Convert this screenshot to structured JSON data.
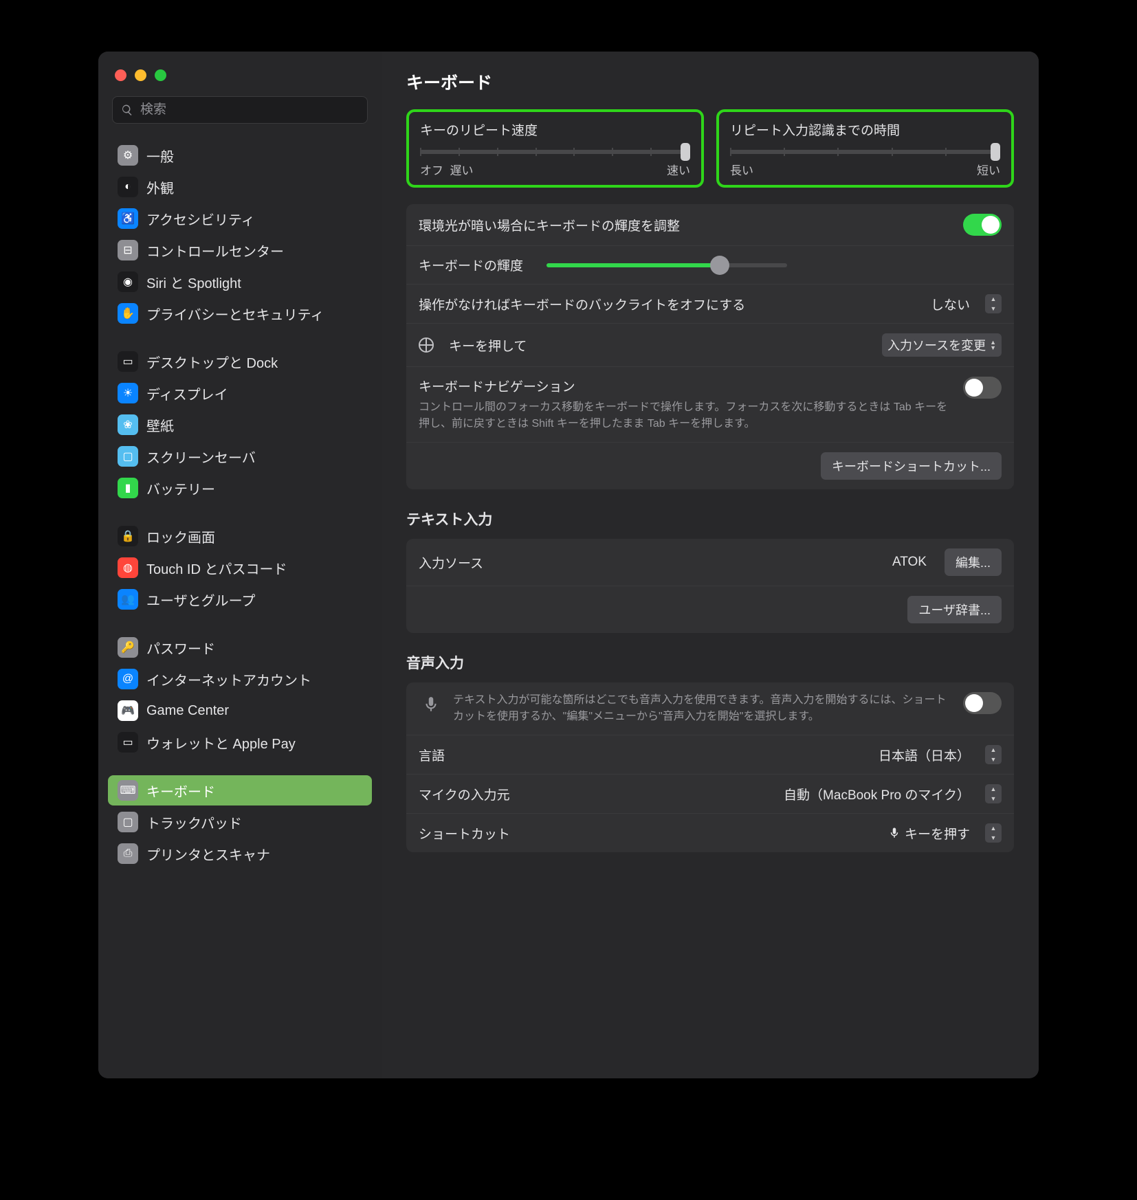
{
  "search_placeholder": "検索",
  "page_title": "キーボード",
  "sidebar": [
    {
      "label": "一般",
      "color": "#8e8e93",
      "glyph": "⚙"
    },
    {
      "label": "外観",
      "color": "#1c1c1e",
      "glyph": "◐"
    },
    {
      "label": "アクセシビリティ",
      "color": "#0a84ff",
      "glyph": "♿"
    },
    {
      "label": "コントロールセンター",
      "color": "#8e8e93",
      "glyph": "⊟"
    },
    {
      "label": "Siri と Spotlight",
      "color": "#1c1c1e",
      "glyph": "◉"
    },
    {
      "label": "プライバシーとセキュリティ",
      "color": "#0a84ff",
      "glyph": "✋"
    },
    {
      "sep": true
    },
    {
      "label": "デスクトップと Dock",
      "color": "#1c1c1e",
      "glyph": "▭"
    },
    {
      "label": "ディスプレイ",
      "color": "#0a84ff",
      "glyph": "☀"
    },
    {
      "label": "壁紙",
      "color": "#55bef0",
      "glyph": "❀"
    },
    {
      "label": "スクリーンセーバ",
      "color": "#55bef0",
      "glyph": "▢"
    },
    {
      "label": "バッテリー",
      "color": "#32d74b",
      "glyph": "▮"
    },
    {
      "sep": true
    },
    {
      "label": "ロック画面",
      "color": "#1c1c1e",
      "glyph": "🔒"
    },
    {
      "label": "Touch ID とパスコード",
      "color": "#ff453a",
      "glyph": "◍"
    },
    {
      "label": "ユーザとグループ",
      "color": "#0a84ff",
      "glyph": "👥"
    },
    {
      "sep": true
    },
    {
      "label": "パスワード",
      "color": "#8e8e93",
      "glyph": "🔑"
    },
    {
      "label": "インターネットアカウント",
      "color": "#0a84ff",
      "glyph": "@"
    },
    {
      "label": "Game Center",
      "color": "#fff",
      "glyph": "🎮"
    },
    {
      "label": "ウォレットと Apple Pay",
      "color": "#1c1c1e",
      "glyph": "▭"
    },
    {
      "sep": true
    },
    {
      "label": "キーボード",
      "color": "#8e8e93",
      "glyph": "⌨",
      "active": true
    },
    {
      "label": "トラックパッド",
      "color": "#8e8e93",
      "glyph": "▢"
    },
    {
      "label": "プリンタとスキャナ",
      "color": "#8e8e93",
      "glyph": "⎙"
    }
  ],
  "slider1": {
    "title": "キーのリピート速度",
    "left1": "オフ",
    "left2": "遅い",
    "right": "速い"
  },
  "slider2": {
    "title": "リピート入力認識までの時間",
    "left": "長い",
    "right": "短い"
  },
  "group1": {
    "ambient": "環境光が暗い場合にキーボードの輝度を調整",
    "brightness": "キーボードの輝度",
    "backlight_off": "操作がなければキーボードのバックライトをオフにする",
    "backlight_val": "しない",
    "globe_key": "キーを押して",
    "globe_val": "入力ソースを変更",
    "nav_title": "キーボードナビゲーション",
    "nav_desc": "コントロール間のフォーカス移動をキーボードで操作します。フォーカスを次に移動するときは Tab キーを押し、前に戻すときは Shift キーを押したまま Tab キーを押します。",
    "shortcuts_btn": "キーボードショートカット..."
  },
  "text_input": {
    "title": "テキスト入力",
    "source_label": "入力ソース",
    "source_val": "ATOK",
    "edit_btn": "編集...",
    "dict_btn": "ユーザ辞書..."
  },
  "voice": {
    "title": "音声入力",
    "desc": "テキスト入力が可能な箇所はどこでも音声入力を使用できます。音声入力を開始するには、ショートカットを使用するか、\"編集\"メニューから\"音声入力を開始\"を選択します。",
    "lang_label": "言語",
    "lang_val": "日本語（日本）",
    "mic_label": "マイクの入力元",
    "mic_val": "自動（MacBook Pro のマイク）",
    "shortcut_label": "ショートカット",
    "shortcut_val": "キーを押す"
  }
}
